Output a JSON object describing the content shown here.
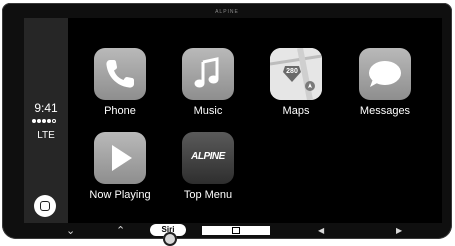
{
  "device": {
    "brand": "ALPINE"
  },
  "status_bar": {
    "time": "9:41",
    "signal_bars_filled": 4,
    "signal_bars_total": 5,
    "network": "LTE"
  },
  "apps": [
    {
      "label": "Phone",
      "icon": "phone-icon"
    },
    {
      "label": "Music",
      "icon": "music-note-icon"
    },
    {
      "label": "Maps",
      "icon": "maps-icon",
      "badge": "280"
    },
    {
      "label": "Messages",
      "icon": "speech-bubble-icon"
    },
    {
      "label": "Now Playing",
      "icon": "play-icon"
    },
    {
      "label": "Top Menu",
      "icon": "alpine-logo-icon",
      "logo_text": "ALPINE"
    }
  ],
  "hardware_controls": {
    "pill_label": "Siri",
    "items": [
      "chevron-down-icon",
      "chevron-up-icon",
      "voice-button",
      "home-bar-button",
      "previous-icon",
      "next-icon"
    ]
  }
}
